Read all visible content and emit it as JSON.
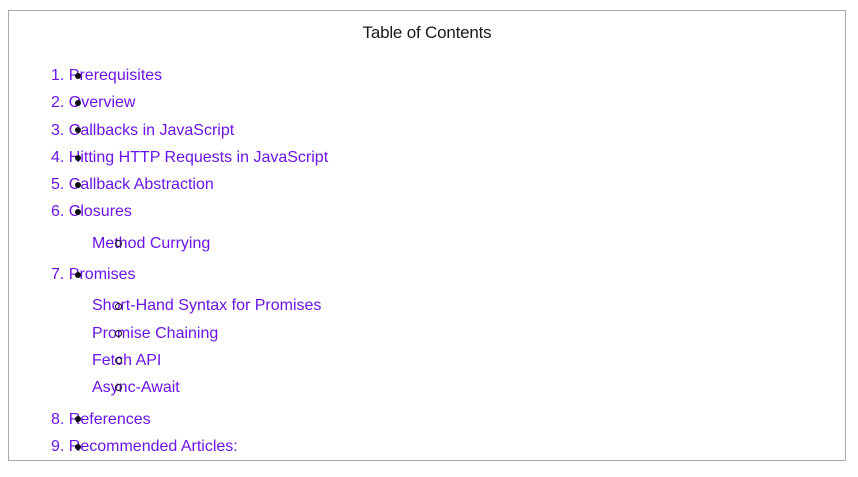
{
  "toc": {
    "title": "Table of Contents",
    "items": [
      {
        "label": "1. Prerequisites"
      },
      {
        "label": "2. Overview"
      },
      {
        "label": "3. Callbacks in JavaScript"
      },
      {
        "label": "4. Hitting HTTP Requests in JavaScript"
      },
      {
        "label": "5. Callback Abstraction"
      },
      {
        "label": "6. Closures",
        "children": [
          {
            "label": "Method Currying"
          }
        ]
      },
      {
        "label": "7. Promises",
        "children": [
          {
            "label": "Short-Hand Syntax for Promises"
          },
          {
            "label": "Promise Chaining"
          },
          {
            "label": "Fetch API"
          },
          {
            "label": "Async-Await"
          }
        ]
      },
      {
        "label": "8. References"
      },
      {
        "label": "9. Recommended Articles:"
      }
    ]
  },
  "colors": {
    "link": "#6b14e8",
    "text": "#1a1a1a",
    "border": "#a9a9a9"
  }
}
